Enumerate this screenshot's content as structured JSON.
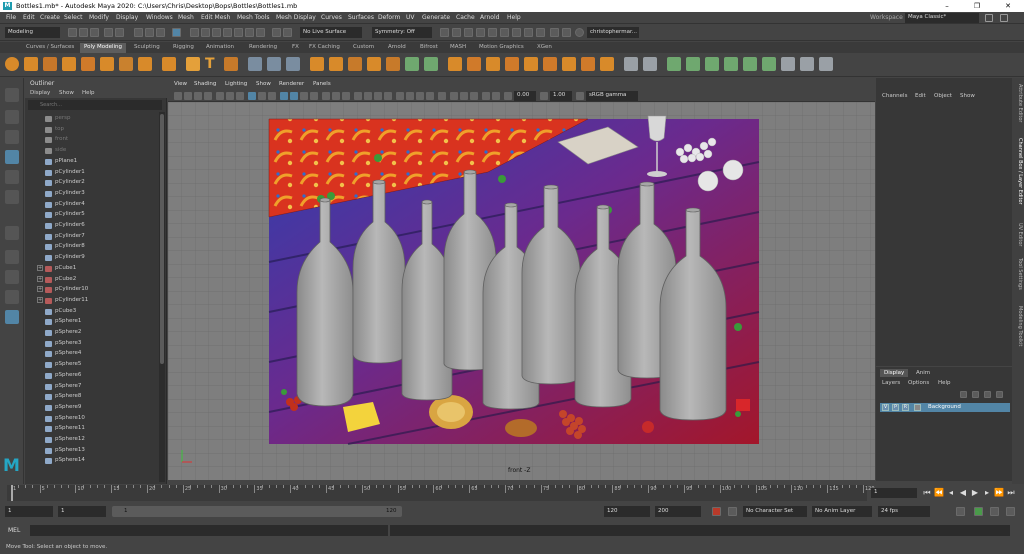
{
  "window": {
    "title": "Bottles1.mb* - Autodesk Maya 2020: C:\\Users\\Chris\\Desktop\\Bops\\Bottles\\Bottles1.mb",
    "controls": [
      "–",
      "❐",
      "✕"
    ]
  },
  "menubar": {
    "items": [
      "File",
      "Edit",
      "Create",
      "Select",
      "Modify",
      "Display",
      "Windows",
      "Mesh",
      "Edit Mesh",
      "Mesh Tools",
      "Mesh Display",
      "Curves",
      "Surfaces",
      "Deform",
      "UV",
      "Generate",
      "Cache",
      "Arnold",
      "Help"
    ],
    "workspace_label": "Workspace :",
    "workspace_value": "Maya Classic*"
  },
  "statusline": {
    "mode": "Modeling",
    "live_surface": "No Live Surface",
    "symmetry": "Symmetry: Off",
    "user": "christophermar..."
  },
  "shelf_tabs": [
    "Curves / Surfaces",
    "Poly Modeling",
    "Sculpting",
    "Rigging",
    "Animation",
    "Rendering",
    "FX",
    "FX Caching",
    "Custom",
    "Arnold",
    "Bifrost",
    "MASH",
    "Motion Graphics",
    "XGen"
  ],
  "shelf_active": "Poly Modeling",
  "outliner": {
    "title": "Outliner",
    "menu": [
      "Display",
      "Show",
      "Help"
    ],
    "search_placeholder": "Search...",
    "items": [
      {
        "label": "persp",
        "type": "camera"
      },
      {
        "label": "top",
        "type": "camera"
      },
      {
        "label": "front",
        "type": "camera"
      },
      {
        "label": "side",
        "type": "camera"
      },
      {
        "label": "pPlane1",
        "type": "mesh"
      },
      {
        "label": "pCylinder1",
        "type": "mesh"
      },
      {
        "label": "pCylinder2",
        "type": "mesh"
      },
      {
        "label": "pCylinder3",
        "type": "mesh"
      },
      {
        "label": "pCylinder4",
        "type": "mesh"
      },
      {
        "label": "pCylinder5",
        "type": "mesh"
      },
      {
        "label": "pCylinder6",
        "type": "mesh"
      },
      {
        "label": "pCylinder7",
        "type": "mesh"
      },
      {
        "label": "pCylinder8",
        "type": "mesh"
      },
      {
        "label": "pCylinder9",
        "type": "mesh"
      },
      {
        "label": "pCube1",
        "type": "group"
      },
      {
        "label": "pCube2",
        "type": "group"
      },
      {
        "label": "pCylinder10",
        "type": "group"
      },
      {
        "label": "pCylinder11",
        "type": "group"
      },
      {
        "label": "pCube3",
        "type": "mesh"
      },
      {
        "label": "pSphere1",
        "type": "mesh"
      },
      {
        "label": "pSphere2",
        "type": "mesh"
      },
      {
        "label": "pSphere3",
        "type": "mesh"
      },
      {
        "label": "pSphere4",
        "type": "mesh"
      },
      {
        "label": "pSphere5",
        "type": "mesh"
      },
      {
        "label": "pSphere6",
        "type": "mesh"
      },
      {
        "label": "pSphere7",
        "type": "mesh"
      },
      {
        "label": "pSphere8",
        "type": "mesh"
      },
      {
        "label": "pSphere9",
        "type": "mesh"
      },
      {
        "label": "pSphere10",
        "type": "mesh"
      },
      {
        "label": "pSphere11",
        "type": "mesh"
      },
      {
        "label": "pSphere12",
        "type": "mesh"
      },
      {
        "label": "pSphere13",
        "type": "mesh"
      },
      {
        "label": "pSphere14",
        "type": "mesh"
      }
    ]
  },
  "viewport": {
    "menu": [
      "View",
      "Shading",
      "Lighting",
      "Show",
      "Renderer",
      "Panels"
    ],
    "field1": "0.00",
    "field2": "1.00",
    "colorspace": "sRGB gamma",
    "camera_label": "front -Z"
  },
  "channelbox": {
    "menu": [
      "Channels",
      "Edit",
      "Object",
      "Show"
    ]
  },
  "layers": {
    "tabs": [
      "Display",
      "Anim"
    ],
    "menu": [
      "Layers",
      "Options",
      "Help"
    ],
    "row": {
      "v": "V",
      "p": "P",
      "r": "R",
      "name": "Background"
    }
  },
  "side_tabs": [
    "Attribute Editor",
    "Channel Box / Layer Editor",
    "UV Editor",
    "Tool Settings",
    "Modeling Toolkit"
  ],
  "timeslider": {
    "labels": [
      "1",
      "5",
      "10",
      "15",
      "20",
      "25",
      "30",
      "35",
      "40",
      "45",
      "50",
      "55",
      "60",
      "65",
      "70",
      "75",
      "80",
      "85",
      "90",
      "95",
      "100",
      "105",
      "110",
      "115",
      "120"
    ],
    "current_frame": "1"
  },
  "range": {
    "start": "1",
    "start2": "1",
    "slider_start": "1",
    "slider_end": "120",
    "end": "120",
    "end2": "200",
    "character_set": "No Character Set",
    "anim_layer": "No Anim Layer",
    "fps": "24 fps"
  },
  "command": {
    "label": "MEL"
  },
  "helpline": "Move Tool: Select an object to move.",
  "colors": {
    "accent": "#5285a6",
    "maya_logo": "#25a6c4"
  }
}
